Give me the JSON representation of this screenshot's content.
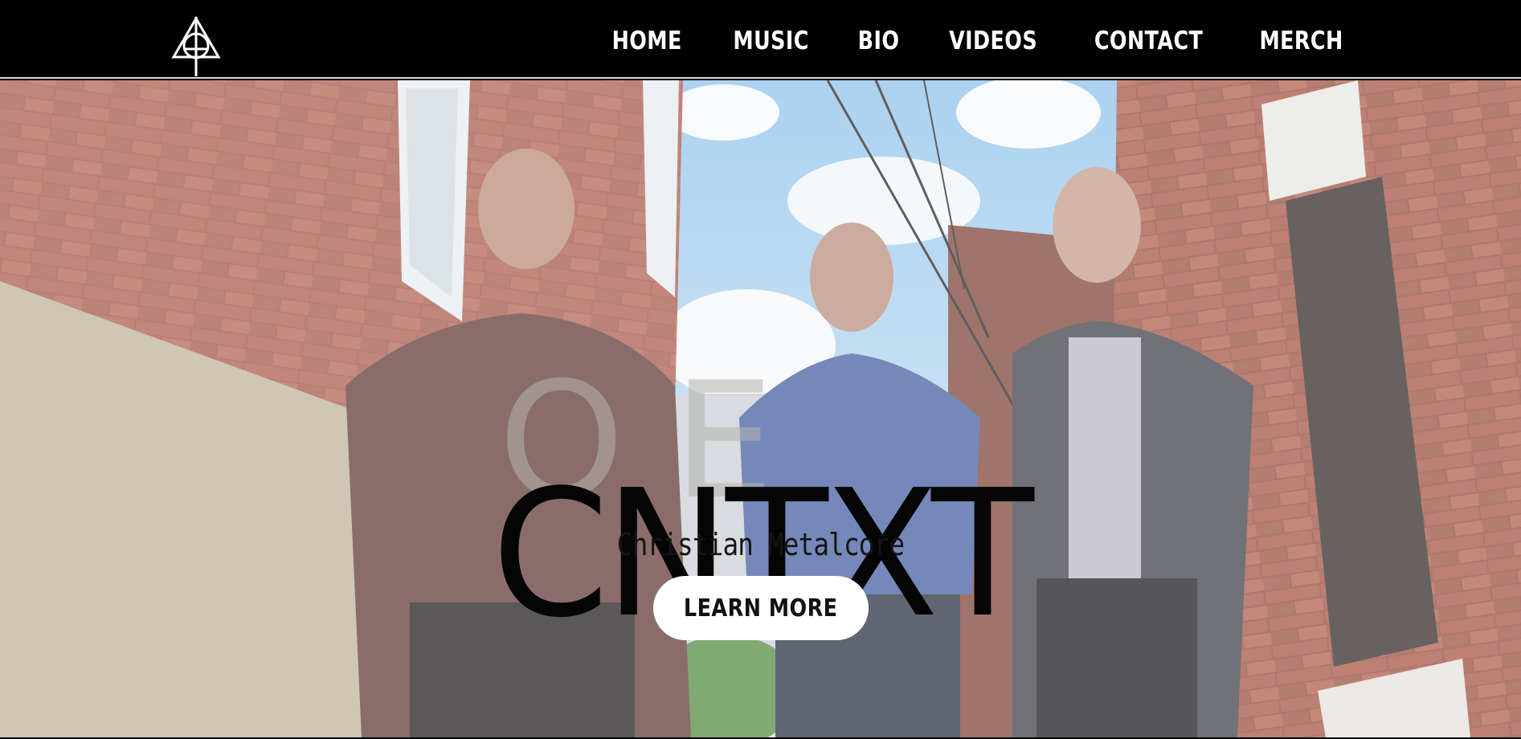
{
  "header": {
    "logo_icon": "band-cross-logo-icon",
    "nav": [
      {
        "label": "HOME"
      },
      {
        "label": "MUSIC"
      },
      {
        "label": "BIO"
      },
      {
        "label": "VIDEOS"
      },
      {
        "label": "CONTACT"
      },
      {
        "label": "MERCH"
      }
    ]
  },
  "hero": {
    "band_name": "CNTXT",
    "tagline": "Christian Metalcore",
    "cta_label": "LEARN MORE"
  },
  "colors": {
    "header_bg": "#000000",
    "nav_text": "#ffffff",
    "brick": "#9a4a3c",
    "sky": "#9ec8ec",
    "button_bg": "#ffffff",
    "headline": "#050505"
  }
}
